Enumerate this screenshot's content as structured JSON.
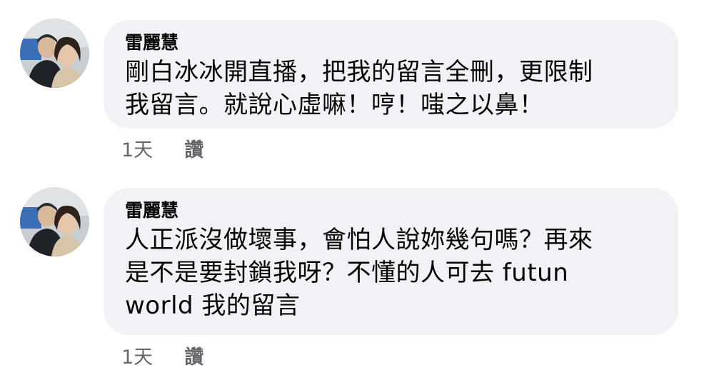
{
  "comments": [
    {
      "author": "雷麗慧",
      "text": "剛白冰冰開直播，把我的留言全刪，更限制\n我留言。就說心虛嘛！哼！嗤之以鼻！",
      "time": "1天",
      "like_label": "讚"
    },
    {
      "author": "雷麗慧",
      "text": "人正派沒做壞事，會怕人說妳幾句嗎？再來\n是不是要封鎖我呀？不懂的人可去 futun\nworld 我的留言",
      "time": "1天",
      "like_label": "讚"
    }
  ],
  "colors": {
    "bubble": "#f0f2f5",
    "text": "#050505",
    "meta": "#65676b"
  }
}
